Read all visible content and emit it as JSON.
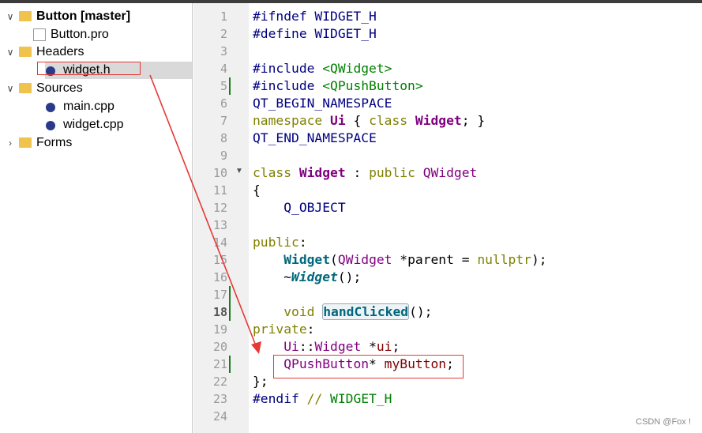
{
  "project_tree": [
    {
      "label": "Button [master]",
      "icon": "qt-project-folder-icon",
      "chevron": "expanded",
      "indent": 0,
      "bold": true
    },
    {
      "label": "Button.pro",
      "icon": "qt-pro-file-icon",
      "chevron": "none",
      "indent": 1
    },
    {
      "label": "Headers",
      "icon": "headers-folder-icon",
      "chevron": "expanded",
      "indent": 0
    },
    {
      "label": "widget.h",
      "icon": "header-file-icon",
      "chevron": "none",
      "indent": 2,
      "selected": true
    },
    {
      "label": "Sources",
      "icon": "sources-folder-icon",
      "chevron": "expanded",
      "indent": 0
    },
    {
      "label": "main.cpp",
      "icon": "cpp-file-icon",
      "chevron": "none",
      "indent": 2
    },
    {
      "label": "widget.cpp",
      "icon": "cpp-file-icon",
      "chevron": "none",
      "indent": 2
    },
    {
      "label": "Forms",
      "icon": "forms-folder-icon",
      "chevron": "collapsed",
      "indent": 0
    }
  ],
  "editor": {
    "current_line": 18,
    "modified_lines": [
      5,
      17,
      18,
      21
    ],
    "fold_markers": [
      10
    ],
    "lines": [
      {
        "n": "1",
        "tokens": [
          {
            "t": "#ifndef WIDGET_H",
            "c": "pp"
          }
        ]
      },
      {
        "n": "2",
        "tokens": [
          {
            "t": "#define WIDGET_H",
            "c": "pp"
          }
        ]
      },
      {
        "n": "3",
        "tokens": []
      },
      {
        "n": "4",
        "tokens": [
          {
            "t": "#include ",
            "c": "pp"
          },
          {
            "t": "<QWidget>",
            "c": "inc"
          }
        ]
      },
      {
        "n": "5",
        "tokens": [
          {
            "t": "#include ",
            "c": "pp"
          },
          {
            "t": "<QPushButton>",
            "c": "inc"
          }
        ]
      },
      {
        "n": "6",
        "tokens": [
          {
            "t": "QT_BEGIN_NAMESPACE",
            "c": "pp"
          }
        ]
      },
      {
        "n": "7",
        "tokens": [
          {
            "t": "namespace ",
            "c": "kw"
          },
          {
            "t": "Ui",
            "c": "clsb"
          },
          {
            "t": " { ",
            "c": "op"
          },
          {
            "t": "class ",
            "c": "kw"
          },
          {
            "t": "Widget",
            "c": "clsb"
          },
          {
            "t": "; }",
            "c": "op"
          }
        ]
      },
      {
        "n": "8",
        "tokens": [
          {
            "t": "QT_END_NAMESPACE",
            "c": "pp"
          }
        ]
      },
      {
        "n": "9",
        "tokens": []
      },
      {
        "n": "10",
        "tokens": [
          {
            "t": "class ",
            "c": "kw"
          },
          {
            "t": "Widget",
            "c": "clsb"
          },
          {
            "t": " : ",
            "c": "op"
          },
          {
            "t": "public ",
            "c": "kw"
          },
          {
            "t": "QWidget",
            "c": "cls"
          }
        ]
      },
      {
        "n": "11",
        "tokens": [
          {
            "t": "{",
            "c": "op"
          }
        ]
      },
      {
        "n": "12",
        "tokens": [
          {
            "t": "    Q_OBJECT",
            "c": "pp"
          }
        ]
      },
      {
        "n": "13",
        "tokens": []
      },
      {
        "n": "14",
        "tokens": [
          {
            "t": "public",
            "c": "kw"
          },
          {
            "t": ":",
            "c": "op"
          }
        ]
      },
      {
        "n": "15",
        "tokens": [
          {
            "t": "    ",
            "c": "op"
          },
          {
            "t": "Widget",
            "c": "fn"
          },
          {
            "t": "(",
            "c": "op"
          },
          {
            "t": "QWidget",
            "c": "cls"
          },
          {
            "t": " *parent = ",
            "c": "op"
          },
          {
            "t": "nullptr",
            "c": "kw"
          },
          {
            "t": ");",
            "c": "op"
          }
        ]
      },
      {
        "n": "16",
        "tokens": [
          {
            "t": "    ~",
            "c": "op"
          },
          {
            "t": "Widget",
            "c": "fni"
          },
          {
            "t": "();",
            "c": "op"
          }
        ]
      },
      {
        "n": "17",
        "tokens": []
      },
      {
        "n": "18",
        "tokens": [
          {
            "t": "    ",
            "c": "op"
          },
          {
            "t": "void ",
            "c": "kw"
          },
          {
            "t": "handClicked",
            "c": "hl"
          },
          {
            "t": "();",
            "c": "op"
          }
        ]
      },
      {
        "n": "19",
        "tokens": [
          {
            "t": "private",
            "c": "kw"
          },
          {
            "t": ":",
            "c": "op"
          }
        ]
      },
      {
        "n": "20",
        "tokens": [
          {
            "t": "    ",
            "c": "op"
          },
          {
            "t": "Ui",
            "c": "cls"
          },
          {
            "t": "::",
            "c": "op"
          },
          {
            "t": "Widget",
            "c": "cls"
          },
          {
            "t": " *",
            "c": "op"
          },
          {
            "t": "ui",
            "c": "mem"
          },
          {
            "t": ";",
            "c": "op"
          }
        ]
      },
      {
        "n": "21",
        "tokens": [
          {
            "t": "    ",
            "c": "op"
          },
          {
            "t": "QPushButton",
            "c": "cls"
          },
          {
            "t": "* ",
            "c": "op"
          },
          {
            "t": "myButton",
            "c": "mem"
          },
          {
            "t": ";",
            "c": "op"
          }
        ]
      },
      {
        "n": "22",
        "tokens": [
          {
            "t": "};",
            "c": "op"
          }
        ]
      },
      {
        "n": "23",
        "tokens": [
          {
            "t": "#endif ",
            "c": "pp"
          },
          {
            "t": "// ",
            "c": "kw"
          },
          {
            "t": "WIDGET_H",
            "c": "cm"
          }
        ]
      },
      {
        "n": "24",
        "tokens": []
      }
    ]
  },
  "annotation_color": "#e53935",
  "watermark": "CSDN @Fox !"
}
